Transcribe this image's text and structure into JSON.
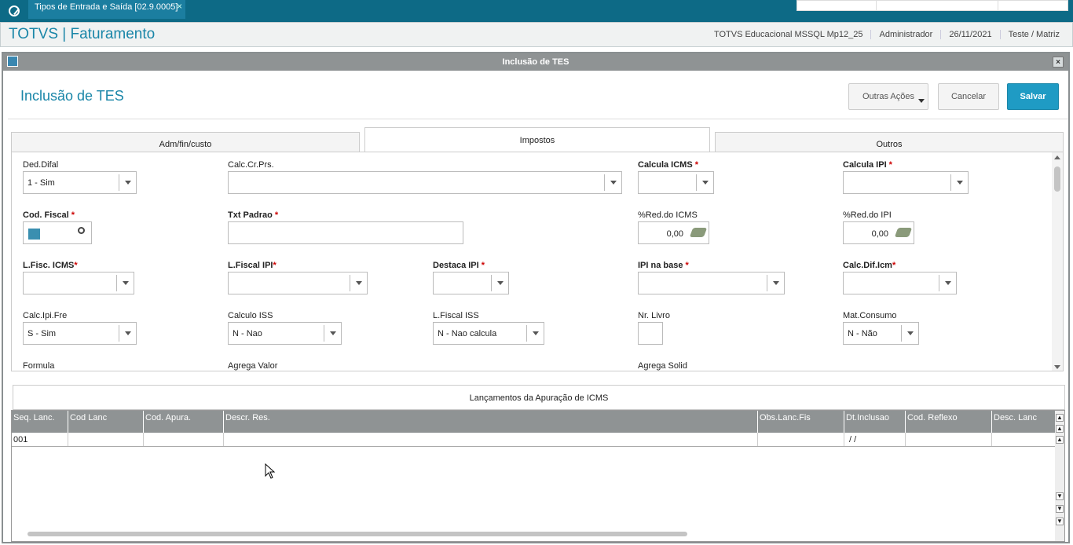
{
  "topbar": {
    "tab_label": "Tipos de Entrada e Saída [02.9.0005]",
    "tab_close": "×"
  },
  "header": {
    "app_title": "TOTVS | Faturamento",
    "environment": "TOTVS Educacional MSSQL Mp12_25",
    "user": "Administrador",
    "date": "26/11/2021",
    "company": "Teste / Matriz"
  },
  "dialog": {
    "title": "Inclusão de TES",
    "close": "×",
    "page_title": "Inclusão de TES",
    "buttons": {
      "outras": "Outras Ações",
      "cancel": "Cancelar",
      "save": "Salvar"
    }
  },
  "tabs": {
    "adm": "Adm/fin/custo",
    "impostos": "Impostos",
    "outros": "Outros"
  },
  "form": {
    "ded_difal": {
      "label": "Ded.Difal",
      "value": "1 - Sim"
    },
    "calc_cr_prs": {
      "label": "Calc.Cr.Prs.",
      "value": ""
    },
    "calcula_icms": {
      "label": "Calcula ICMS",
      "req": "*",
      "value": ""
    },
    "calcula_ipi": {
      "label": "Calcula IPI",
      "req": "*",
      "value": ""
    },
    "cod_fiscal": {
      "label": "Cod. Fiscal",
      "req": "*"
    },
    "txt_padrao": {
      "label": "Txt Padrao",
      "req": "*"
    },
    "red_icms": {
      "label": "%Red.do ICMS",
      "value": "0,00"
    },
    "red_ipi": {
      "label": "%Red.do IPI",
      "value": "0,00"
    },
    "lfisc_icms": {
      "label": "L.Fisc. ICMS",
      "req": "*"
    },
    "lfiscal_ipi": {
      "label": "L.Fiscal IPI",
      "req": "*"
    },
    "destaca_ipi": {
      "label": "Destaca IPI",
      "req": "*"
    },
    "ipi_na_base": {
      "label": "IPI na base",
      "req": "*"
    },
    "calc_dif_icm": {
      "label": "Calc.Dif.Icm",
      "req": "*"
    },
    "calc_ipi_fre": {
      "label": "Calc.Ipi.Fre",
      "value": "S - Sim"
    },
    "calculo_iss": {
      "label": "Calculo ISS",
      "value": "N - Nao"
    },
    "lfiscal_iss": {
      "label": "L.Fiscal ISS",
      "value": "N - Nao calcula"
    },
    "nr_livro": {
      "label": "Nr. Livro"
    },
    "mat_consumo": {
      "label": "Mat.Consumo",
      "value": "N - Não"
    },
    "formula": {
      "label": "Formula"
    },
    "agrega_valor": {
      "label": "Agrega Valor"
    },
    "agrega_solid": {
      "label": "Agrega Solid"
    }
  },
  "grid": {
    "title": "Lançamentos da Apuração de ICMS",
    "columns": [
      "Seq. Lanc.",
      "Cod Lanc",
      "Cod. Apura.",
      "Descr. Res.",
      "Obs.Lanc.Fis",
      "Dt.Inclusao",
      "Cod. Reflexo",
      "Desc. Lanc"
    ],
    "row": [
      "001",
      "",
      "",
      "",
      "",
      "/  /",
      "",
      ""
    ]
  }
}
